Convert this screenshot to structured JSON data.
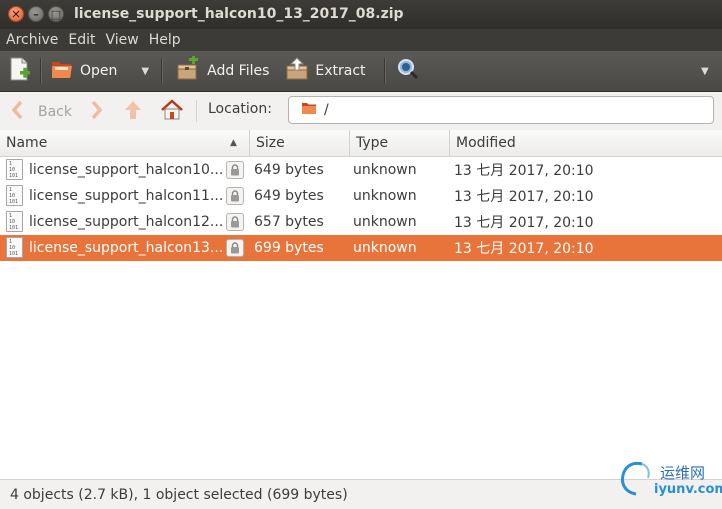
{
  "window": {
    "title": "license_support_halcon10_13_2017_08.zip",
    "close_glyph": "✕",
    "minimize_glyph": "–",
    "maximize_glyph": "□"
  },
  "menubar": {
    "items": [
      {
        "label": "Archive"
      },
      {
        "label": "Edit"
      },
      {
        "label": "View"
      },
      {
        "label": "Help"
      }
    ]
  },
  "toolbar": {
    "new_icon": "new-archive-icon",
    "open_label": "Open",
    "open_icon": "open-archive-icon",
    "add_files_label": "Add Files",
    "add_files_icon": "add-files-icon",
    "extract_label": "Extract",
    "extract_icon": "extract-icon",
    "search_icon": "search-icon"
  },
  "location_bar": {
    "back_label": "Back",
    "location_label": "Location:",
    "path": "/"
  },
  "columns": {
    "name": "Name",
    "size": "Size",
    "type": "Type",
    "modified": "Modified"
  },
  "files": [
    {
      "name": "license_support_halcon10...",
      "size": "649 bytes",
      "type": "unknown",
      "modified": "13 七月 2017, 20:10",
      "encrypted": true,
      "selected": false
    },
    {
      "name": "license_support_halcon11...",
      "size": "649 bytes",
      "type": "unknown",
      "modified": "13 七月 2017, 20:10",
      "encrypted": true,
      "selected": false
    },
    {
      "name": "license_support_halcon12...",
      "size": "657 bytes",
      "type": "unknown",
      "modified": "13 七月 2017, 20:10",
      "encrypted": true,
      "selected": false
    },
    {
      "name": "license_support_halcon13...",
      "size": "699 bytes",
      "type": "unknown",
      "modified": "13 七月 2017, 20:10",
      "encrypted": true,
      "selected": true
    }
  ],
  "status": {
    "text": "4 objects (2.7 kB), 1 object selected (699 bytes)"
  },
  "watermark": {
    "line1": "运维网",
    "line2": "iyunv.com"
  },
  "colors": {
    "selection": "#e8743b",
    "titlebar": "#3c3b37",
    "close_button": "#e0592a"
  }
}
